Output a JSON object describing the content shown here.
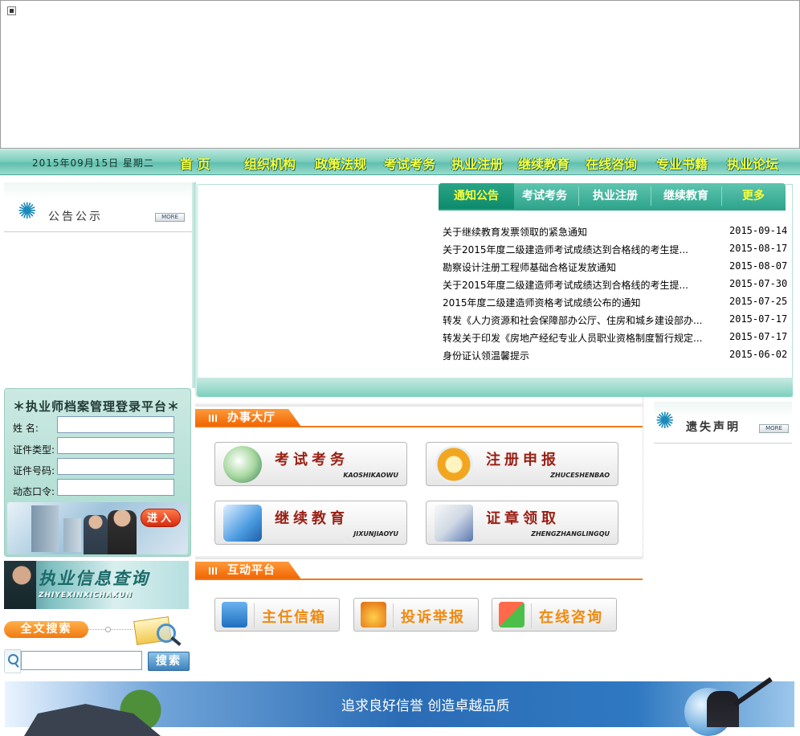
{
  "nav": {
    "date": "2015年09月15日  星期二",
    "items": [
      "首  页",
      "组织机构",
      "政策法规",
      "考试考务",
      "执业注册",
      "继续教育",
      "在线咨询",
      "专业书籍",
      "执业论坛"
    ]
  },
  "notice_board": {
    "title": "公告公示",
    "more": "MORE"
  },
  "login": {
    "title": "＊执业师档案管理登录平台＊",
    "fields": [
      {
        "label": "姓    名:",
        "value": ""
      },
      {
        "label": "证件类型:",
        "value": ""
      },
      {
        "label": "证件号码:",
        "value": ""
      },
      {
        "label": "动态口令:",
        "value": ""
      }
    ],
    "enter": "进入"
  },
  "info_query": {
    "title": "执业信息查询",
    "subtitle": "ZHIYEXINXICHAXUN"
  },
  "fulltext": {
    "label": "全文搜索",
    "search_value": "",
    "button": "搜索"
  },
  "news": {
    "tabs": [
      "通知公告",
      "考试考务",
      "执业注册",
      "继续教育"
    ],
    "more": "更多",
    "items": [
      {
        "title": "关于继续教育发票领取的紧急通知",
        "date": "2015-09-14"
      },
      {
        "title": "关于2015年度二级建造师考试成绩达到合格线的考生提...",
        "date": "2015-08-17"
      },
      {
        "title": "勘察设计注册工程师基础合格证发放通知",
        "date": "2015-08-07"
      },
      {
        "title": "关于2015年度二级建造师考试成绩达到合格线的考生提...",
        "date": "2015-07-30"
      },
      {
        "title": "2015年度二级建造师资格考试成绩公布的通知",
        "date": "2015-07-25"
      },
      {
        "title": "转发《人力资源和社会保障部办公厅、住房和城乡建设部办...",
        "date": "2015-07-17"
      },
      {
        "title": "转发关于印发《房地产经纪专业人员职业资格制度暂行规定...",
        "date": "2015-07-17"
      },
      {
        "title": "身份证认领温馨提示",
        "date": "2015-06-02"
      }
    ]
  },
  "hall": {
    "title": "办事大厅",
    "tiles": [
      {
        "title": "考试考务",
        "sub": "KAOSHIKAOWU"
      },
      {
        "title": "注册申报",
        "sub": "ZHUCESHENBAO"
      },
      {
        "title": "继续教育",
        "sub": "JIXUNJIAOYU"
      },
      {
        "title": "证章领取",
        "sub": "ZHENGZHANGLINGQU"
      }
    ]
  },
  "interactive": {
    "title": "互动平台",
    "tiles": [
      "主任信箱",
      "投诉举报",
      "在线咨询"
    ]
  },
  "lost": {
    "title": "遗失声明",
    "more": "MORE"
  },
  "bottom_banner": {
    "slogan": "追求良好信誉 创造卓越品质"
  },
  "colors": {
    "nav_text": "#f6ff3a",
    "teal": "#2fa58c",
    "orange": "#f06400",
    "tile_title": "#9a1f14"
  }
}
